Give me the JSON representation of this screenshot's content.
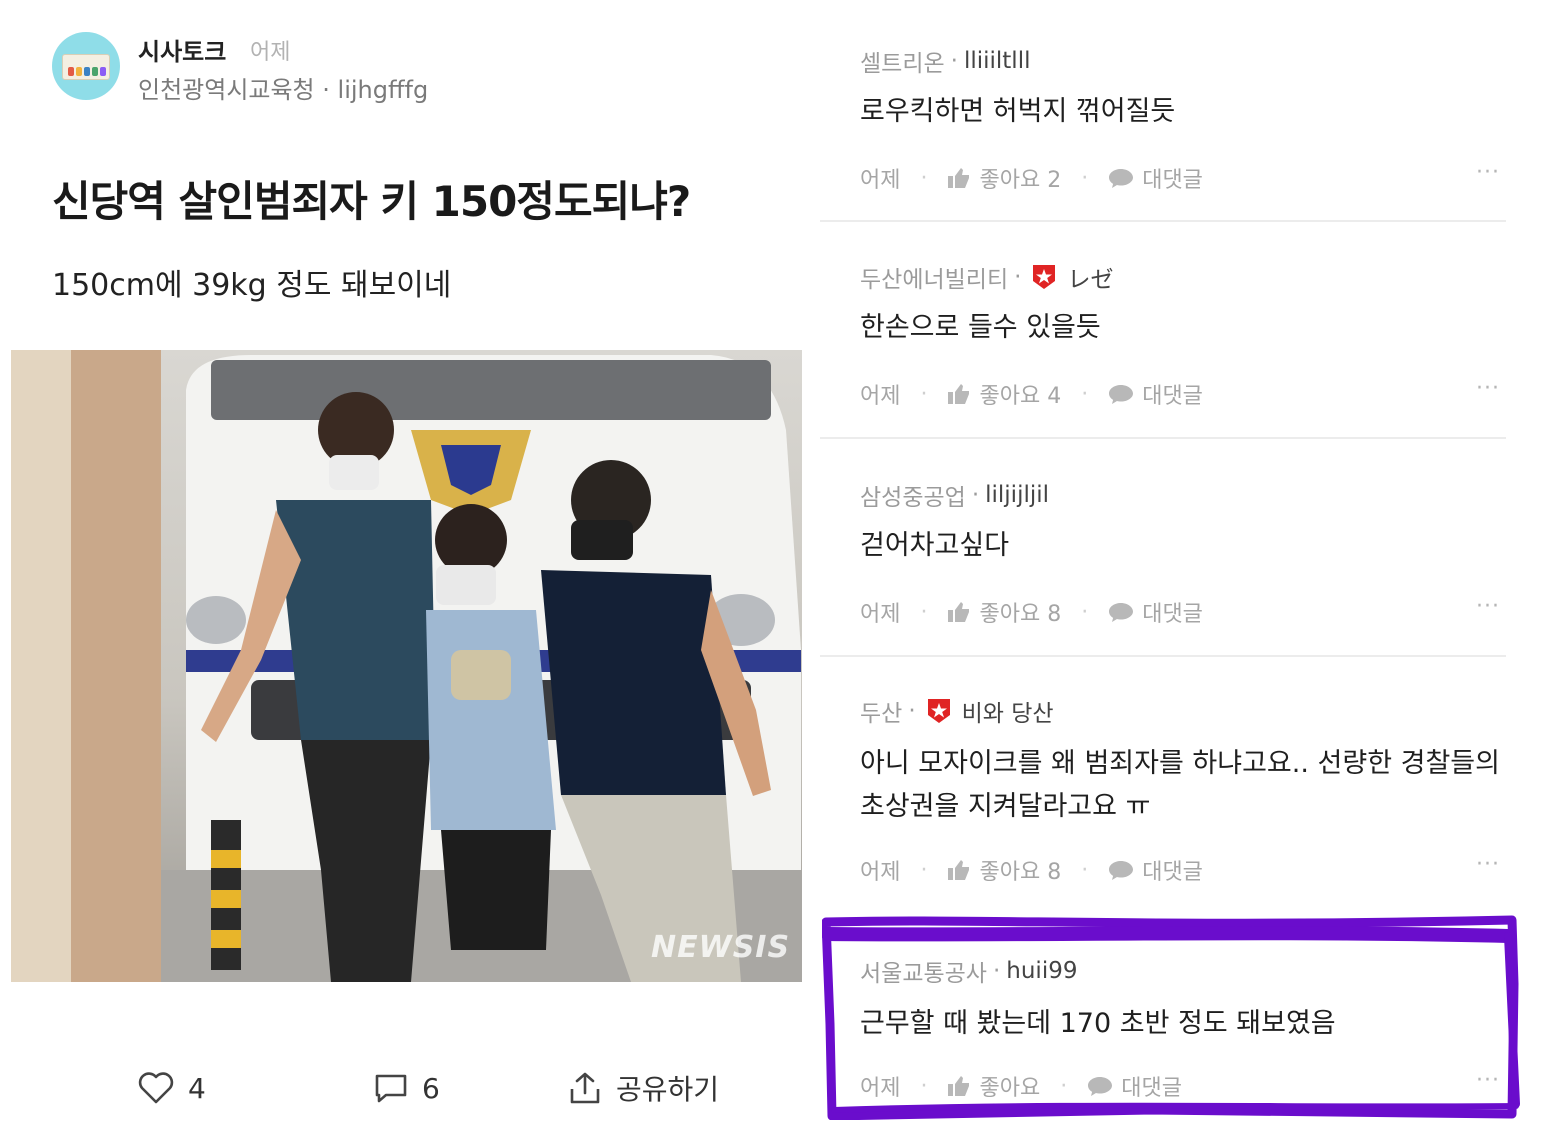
{
  "post": {
    "channel": "시사토크",
    "time": "어제",
    "author_line": "인천광역시교육청 · lijhgfffg",
    "title": "신당역 살인범죄자 키 150정도되냐?",
    "body": "150cm에 39kg 정도 돼보이네",
    "image_watermark": "NEWSIS",
    "likes": "4",
    "comments": "6",
    "share_label": "공유하기"
  },
  "comments": [
    {
      "company": "셀트리온",
      "nick": "lliiiltlll",
      "text": "로우킥하면 허벅지 꺾어질듯",
      "time": "어제",
      "likes": "좋아요 2",
      "reply": "대댓글"
    },
    {
      "company": "두산에너빌리티",
      "nick": "レゼ",
      "badge": true,
      "text": "한손으로 들수 있을듯",
      "time": "어제",
      "likes": "좋아요 4",
      "reply": "대댓글"
    },
    {
      "company": "삼성중공업",
      "nick": "liljijljil",
      "text": "걷어차고싶다",
      "time": "어제",
      "likes": "좋아요 8",
      "reply": "대댓글"
    },
    {
      "company": "두산",
      "nick": "비와 당산",
      "badge": true,
      "text_line1": "아니 모자이크를 왜 범죄자를 하냐고요.. 선량한 경찰들의",
      "text_line2": "초상권을 지켜달라고요 ㅠ",
      "time": "어제",
      "likes": "좋아요 8",
      "reply": "대댓글"
    },
    {
      "company": "서울교통공사",
      "nick": "huii99",
      "text": "근무할 때 봤는데 170 초반 정도 돼보였음",
      "time": "어제",
      "likes": "좋아요",
      "reply": "대댓글"
    }
  ],
  "more_label": "···",
  "colors": {
    "highlight": "#6a0dcc",
    "badge_red": "#e02424",
    "muted_text": "#9b9b9b"
  }
}
